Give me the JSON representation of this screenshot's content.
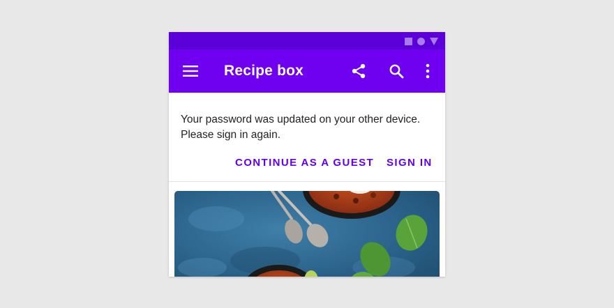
{
  "app_bar": {
    "title": "Recipe box",
    "background": "#6f00f0",
    "icons": [
      "menu-icon",
      "share-icon",
      "search-icon",
      "more-vert-icon"
    ]
  },
  "status_bar": {
    "background": "#5b00d8",
    "icons": [
      "square-icon",
      "circle-icon",
      "triangle-icon"
    ]
  },
  "banner": {
    "message_line1": "Your password was updated on your other device.",
    "message_line2": "Please sign in again.",
    "guest_button_label": "CONTINUE AS A GUEST",
    "signin_button_label": "SIGN IN",
    "accent": "#6200ea"
  },
  "card": {
    "image_subject": "chili-bowls-on-blue-surface"
  }
}
